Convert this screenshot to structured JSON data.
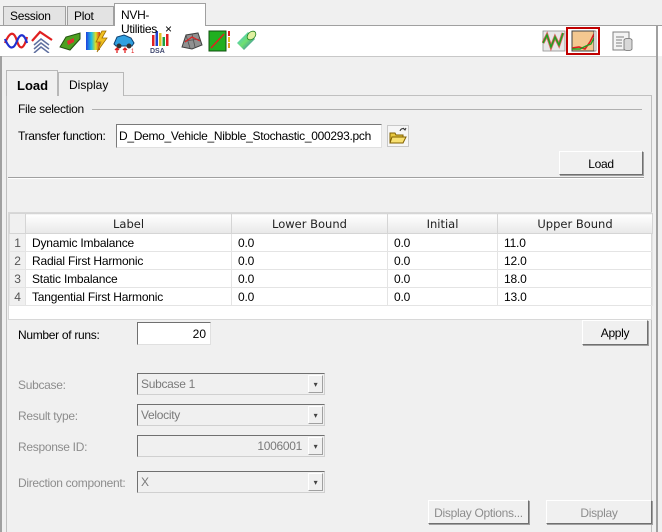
{
  "top_tabs": [
    {
      "label": "Session"
    },
    {
      "label": "Plot"
    },
    {
      "label": "NVH-Utilities",
      "active": true,
      "close_icon": "×"
    }
  ],
  "toolbar": {
    "icons": [
      "frf-curves-icon",
      "order-curves-icon",
      "vehicle-model-icon",
      "energy-distribution-icon",
      "vehicle-loads-icon",
      "dsa-bar-chart-icon",
      "panel-mesh-icon",
      "contour-plot-icon",
      "cylinder-shape-icon"
    ],
    "right_icons": [
      "waveform-plot-icon",
      "stochastic-plot-icon",
      "data-table-icon"
    ],
    "selected_right_icon": "stochastic-plot-icon",
    "dsa_label": "DSA"
  },
  "inner_tabs": [
    {
      "label": "Load",
      "active": true
    },
    {
      "label": "Display"
    }
  ],
  "file_selection": {
    "group_label": "File selection",
    "transfer_function_label": "Transfer function:",
    "transfer_function_value": "D_Demo_Vehicle_Nibble_Stochastic_000293.pch",
    "browse_icon": "folder-open-icon",
    "load_button": "Load"
  },
  "table": {
    "columns": [
      "Label",
      "Lower Bound",
      "Initial",
      "Upper Bound"
    ],
    "rows": [
      {
        "num": "1",
        "label": "Dynamic Imbalance",
        "lower": "0.0",
        "initial": "0.0",
        "upper": "11.0"
      },
      {
        "num": "2",
        "label": "Radial First Harmonic",
        "lower": "0.0",
        "initial": "0.0",
        "upper": "12.0"
      },
      {
        "num": "3",
        "label": "Static Imbalance",
        "lower": "0.0",
        "initial": "0.0",
        "upper": "18.0"
      },
      {
        "num": "4",
        "label": "Tangential First Harmonic",
        "lower": "0.0",
        "initial": "0.0",
        "upper": "13.0"
      }
    ]
  },
  "runs": {
    "label": "Number of runs:",
    "value": "20",
    "apply_button": "Apply"
  },
  "results": {
    "subcase_label": "Subcase:",
    "subcase_value": "Subcase 1",
    "result_type_label": "Result type:",
    "result_type_value": "Velocity",
    "response_id_label": "Response ID:",
    "response_id_value": "1006001",
    "direction_label": "Direction component:",
    "direction_value": "X",
    "dropdown_arrow": "▾"
  },
  "buttons": {
    "display_options": "Display Options...",
    "display": "Display"
  },
  "colors": {
    "selected_icon_border": "#c00000",
    "disabled_text": "#8d8d8d"
  }
}
